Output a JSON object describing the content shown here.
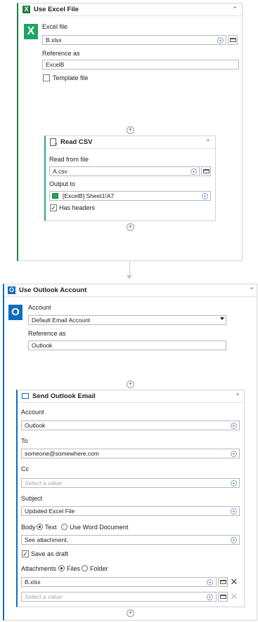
{
  "excel_block": {
    "title": "Use Excel File",
    "excel_file_label": "Excel file",
    "excel_file_value": "B.xlsx",
    "reference_label": "Reference as",
    "reference_value": "ExcelB",
    "template_label": "Template file",
    "read_csv": {
      "title": "Read CSV",
      "read_from_label": "Read from file",
      "read_from_value": "A.csv",
      "output_label": "Output to",
      "output_value": "[ExcelB] Sheet1!A7",
      "has_headers_label": "Has headers"
    }
  },
  "outlook_block": {
    "title": "Use Outlook Account",
    "account_label": "Account",
    "account_value": "Default Email Account",
    "reference_label": "Reference as",
    "reference_value": "Outlook",
    "send_email": {
      "title": "Send Outlook Email",
      "account_label": "Account",
      "account_value": "Outlook",
      "to_label": "To",
      "to_value": "someone@somewhere.com",
      "cc_label": "Cc",
      "cc_placeholder": "Select a value",
      "subject_label": "Subject",
      "subject_value": "Updated Excel File",
      "body_label": "Body",
      "body_text_option": "Text",
      "body_word_option": "Use Word Document",
      "body_value": "See attachment.",
      "save_draft_label": "Save as draft",
      "attachments_label": "Attachments",
      "attach_files_option": "Files",
      "attach_folder_option": "Folder",
      "attachment_1": "B.xlsx",
      "attachment_2_placeholder": "Select a value"
    }
  },
  "colors": {
    "excel_green": "#1e7e45",
    "outlook_blue": "#0f6cbd",
    "csv_accent": "#2aa198"
  }
}
